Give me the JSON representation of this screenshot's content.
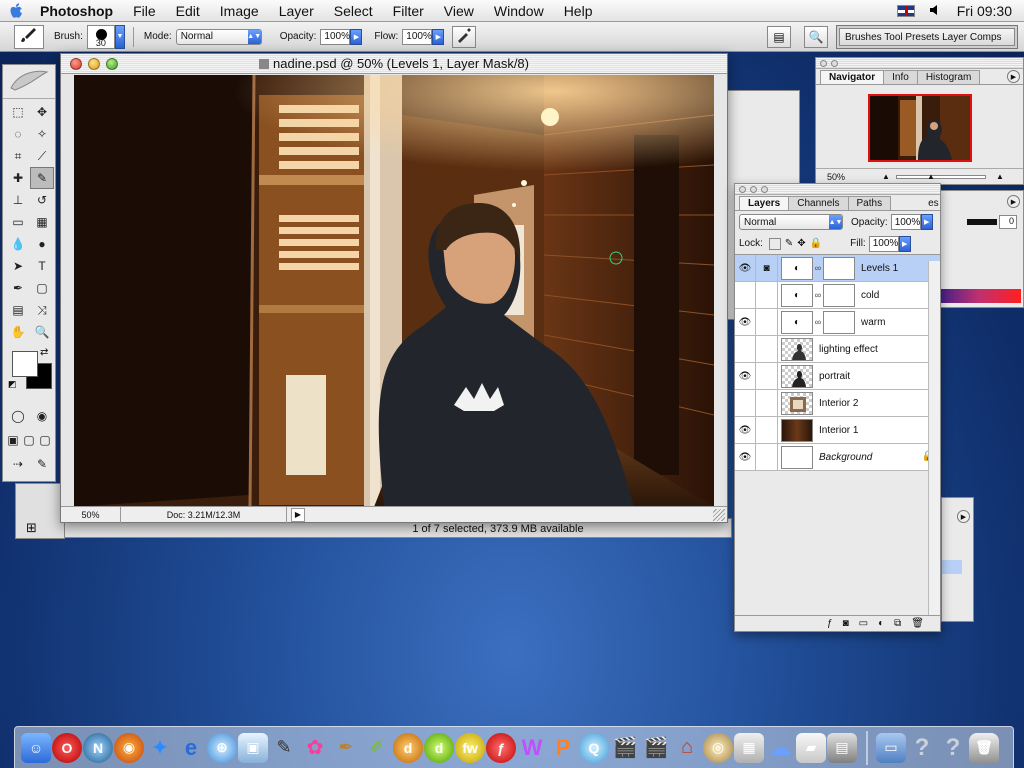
{
  "menubar": {
    "app_name": "Photoshop",
    "items": [
      "File",
      "Edit",
      "Image",
      "Layer",
      "Select",
      "Filter",
      "View",
      "Window",
      "Help"
    ],
    "clock": "Fri 09:30"
  },
  "options": {
    "brush_label": "Brush:",
    "brush_size": "30",
    "mode_label": "Mode:",
    "mode_value": "Normal",
    "opacity_label": "Opacity:",
    "opacity_value": "100%",
    "flow_label": "Flow:",
    "flow_value": "100%",
    "palette_well": "Brushes Tool Presets Layer Comps"
  },
  "document": {
    "title": "nadine.psd @ 50% (Levels 1, Layer Mask/8)",
    "zoom": "50%",
    "doc_size": "Doc: 3.21M/12.3M"
  },
  "finder_status": "1 of 7 selected, 373.9 MB available",
  "navigator": {
    "tabs": [
      "Navigator",
      "Info",
      "Histogram"
    ],
    "zoom": "50%",
    "hidden_field_value": "0"
  },
  "layers_panel": {
    "tabs": [
      "Layers",
      "Channels",
      "Paths"
    ],
    "partial_tab": "es",
    "blend_mode": "Normal",
    "opacity_label": "Opacity:",
    "opacity_value": "100%",
    "lock_label": "Lock:",
    "fill_label": "Fill:",
    "fill_value": "100%",
    "layers": [
      {
        "name": "Levels 1",
        "visible": true,
        "selected": true
      },
      {
        "name": "cold",
        "visible": false,
        "selected": false
      },
      {
        "name": "warm",
        "visible": true,
        "selected": false
      },
      {
        "name": "lighting effect",
        "visible": false,
        "selected": false
      },
      {
        "name": "portrait",
        "visible": true,
        "selected": false
      },
      {
        "name": "Interior 2",
        "visible": false,
        "selected": false
      },
      {
        "name": "Interior 1",
        "visible": true,
        "selected": false
      },
      {
        "name": "Background",
        "visible": true,
        "selected": false
      }
    ]
  },
  "dock": {
    "icons": [
      "finder-icon",
      "opera-icon",
      "netscape-icon",
      "firefox-icon",
      "safari-compass-icon",
      "ie-icon",
      "safari-icon",
      "preview-icon",
      "gimp-icon",
      "flower-icon",
      "pen-icon",
      "brush-app-icon",
      "dreamweaver-icon",
      "dreamweaver-alt-icon",
      "fireworks-icon",
      "flash-icon",
      "word-icon",
      "pencil-app-icon",
      "quicktime-icon",
      "clapper-icon",
      "clapper-alt-icon",
      "photo-icon",
      "dvd-icon",
      "preview-alt-icon",
      "mail-icon",
      "scanner-icon",
      "printer-icon",
      "folder-icon",
      "help-icon",
      "help-alt-icon",
      "trash-icon"
    ]
  },
  "colors": {
    "selection": "#b8d0f6",
    "accent": "#2b63d6",
    "nav_box": "#e01010"
  }
}
